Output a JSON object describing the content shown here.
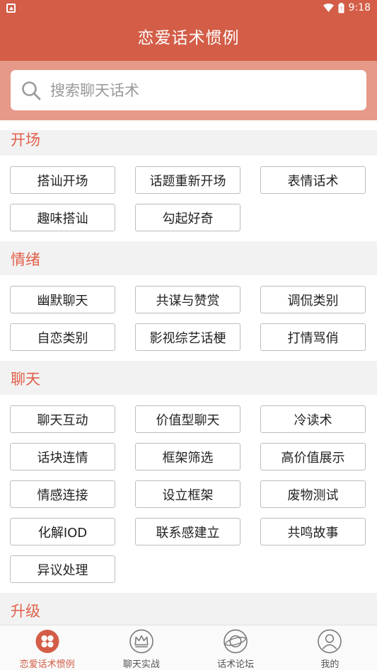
{
  "status_bar": {
    "time": "9:18"
  },
  "header": {
    "title": "恋爱话术惯例"
  },
  "search": {
    "placeholder": "搜索聊天话术"
  },
  "sections": [
    {
      "title": "开场",
      "tags": [
        "搭讪开场",
        "话题重新开场",
        "表情话术",
        "趣味搭讪",
        "勾起好奇"
      ]
    },
    {
      "title": "情绪",
      "tags": [
        "幽默聊天",
        "共谋与赞赏",
        "调侃类别",
        "自恋类别",
        "影视综艺话梗",
        "打情骂俏"
      ]
    },
    {
      "title": "聊天",
      "tags": [
        "聊天互动",
        "价值型聊天",
        "冷读术",
        "话块连情",
        "框架筛选",
        "高价值展示",
        "情感连接",
        "设立框架",
        "废物测试",
        "化解IOD",
        "联系感建立",
        "共鸣故事",
        "异议处理"
      ]
    },
    {
      "title": "升级",
      "tags": []
    }
  ],
  "tabbar": {
    "items": [
      {
        "label": "恋爱话术惯例",
        "icon": "clover-icon",
        "active": true
      },
      {
        "label": "聊天实战",
        "icon": "crown-icon",
        "active": false
      },
      {
        "label": "话术论坛",
        "icon": "planet-icon",
        "active": false
      },
      {
        "label": "我的",
        "icon": "profile-icon",
        "active": false
      }
    ]
  },
  "colors": {
    "accent": "#d35d47",
    "section_title": "#e1604a"
  }
}
